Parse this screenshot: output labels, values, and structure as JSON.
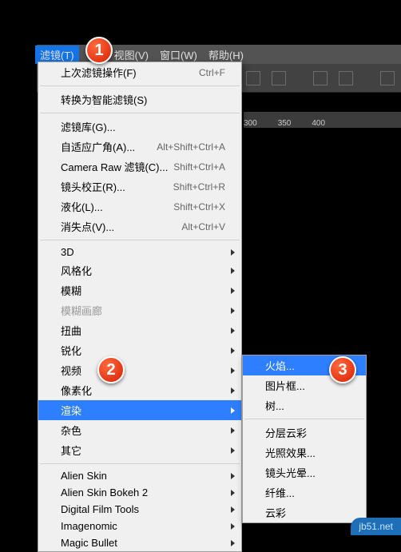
{
  "menubar": {
    "items": [
      {
        "label": "滤镜(T)"
      },
      {
        "label": ""
      },
      {
        "label": "视图(V)"
      },
      {
        "label": "窗口(W)"
      },
      {
        "label": "帮助(H)"
      }
    ]
  },
  "ruler": {
    "marks": [
      "300",
      "350",
      "400"
    ]
  },
  "badges": {
    "b1": "1",
    "b2": "2",
    "b3": "3"
  },
  "menu1": {
    "groups": [
      [
        {
          "label": "上次滤镜操作(F)",
          "shortcut": "Ctrl+F"
        }
      ],
      [
        {
          "label": "转换为智能滤镜(S)"
        }
      ],
      [
        {
          "label": "滤镜库(G)..."
        },
        {
          "label": "自适应广角(A)...",
          "shortcut": "Alt+Shift+Ctrl+A"
        },
        {
          "label": "Camera Raw 滤镜(C)...",
          "shortcut": "Shift+Ctrl+A"
        },
        {
          "label": "镜头校正(R)...",
          "shortcut": "Shift+Ctrl+R"
        },
        {
          "label": "液化(L)...",
          "shortcut": "Shift+Ctrl+X"
        },
        {
          "label": "消失点(V)...",
          "shortcut": "Alt+Ctrl+V"
        }
      ],
      [
        {
          "label": "3D",
          "submenu": true
        },
        {
          "label": "风格化",
          "submenu": true
        },
        {
          "label": "模糊",
          "submenu": true
        },
        {
          "label": "模糊画廊",
          "submenu": true,
          "disabled": true
        },
        {
          "label": "扭曲",
          "submenu": true
        },
        {
          "label": "锐化",
          "submenu": true
        },
        {
          "label": "视频",
          "submenu": true
        },
        {
          "label": "像素化",
          "submenu": true
        },
        {
          "label": "渲染",
          "submenu": true,
          "highlighted": true
        },
        {
          "label": "杂色",
          "submenu": true
        },
        {
          "label": "其它",
          "submenu": true
        }
      ],
      [
        {
          "label": "Alien Skin",
          "submenu": true
        },
        {
          "label": "Alien Skin Bokeh 2",
          "submenu": true
        },
        {
          "label": "Digital Film Tools",
          "submenu": true
        },
        {
          "label": "Imagenomic",
          "submenu": true
        },
        {
          "label": "Magic Bullet",
          "submenu": true
        }
      ]
    ]
  },
  "menu2": {
    "groups": [
      [
        {
          "label": "火焰...",
          "highlighted": true
        },
        {
          "label": "图片框..."
        },
        {
          "label": "树..."
        }
      ],
      [
        {
          "label": "分层云彩"
        },
        {
          "label": "光照效果..."
        },
        {
          "label": "镜头光晕..."
        },
        {
          "label": "纤维..."
        },
        {
          "label": "云彩"
        }
      ]
    ]
  },
  "watermark": "jb51.net"
}
